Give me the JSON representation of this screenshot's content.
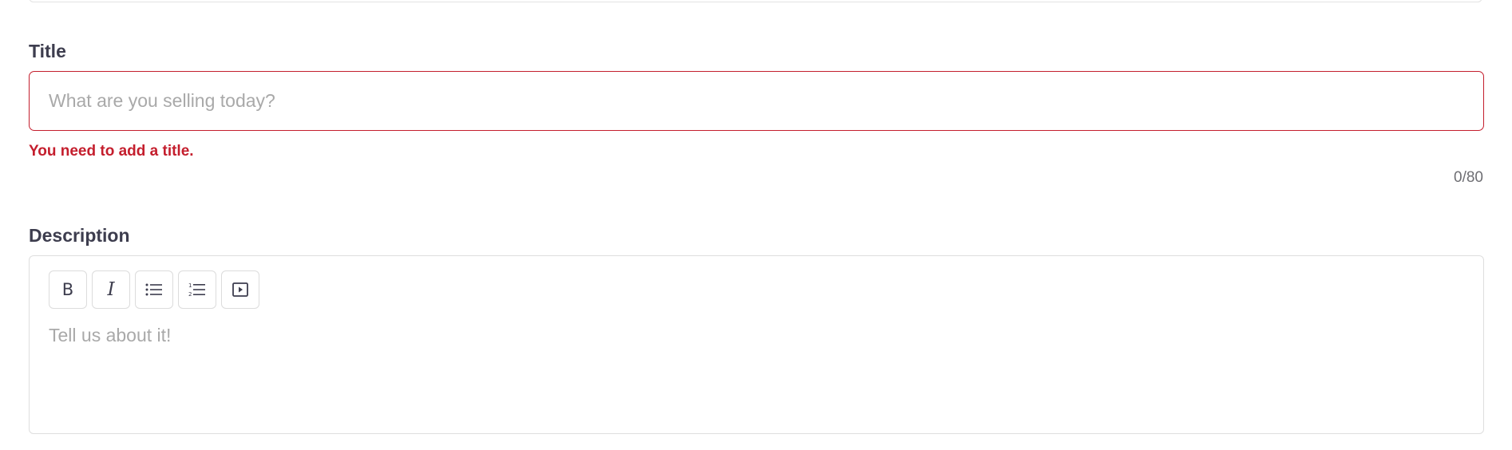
{
  "title_field": {
    "label": "Title",
    "value": "",
    "placeholder": "What are you selling today?",
    "error": "You need to add a title.",
    "counter": "0/80",
    "error_color": "#c41e2d"
  },
  "description_field": {
    "label": "Description",
    "placeholder": "Tell us about it!",
    "toolbar": {
      "bold_label": "B",
      "italic_label": "I",
      "bullet_list_icon": "bullet-list-icon",
      "numbered_list_icon": "numbered-list-icon",
      "embed_video_icon": "play-box-icon"
    }
  }
}
